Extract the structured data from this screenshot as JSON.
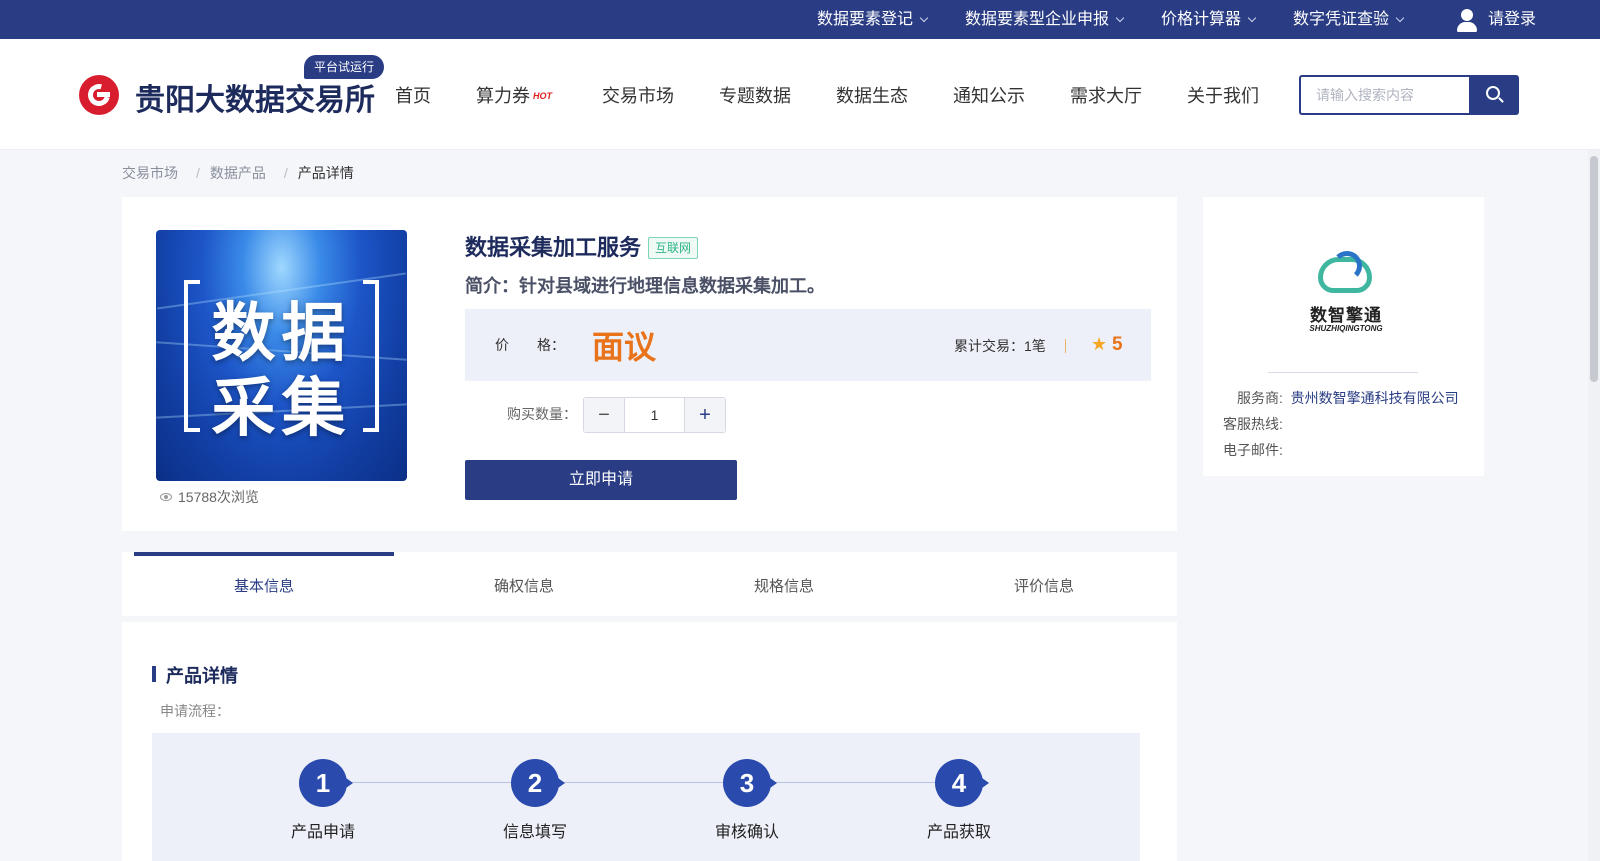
{
  "topbar": {
    "items": [
      {
        "label": "数据要素登记"
      },
      {
        "label": "数据要素型企业申报"
      },
      {
        "label": "价格计算器"
      },
      {
        "label": "数字凭证查验"
      }
    ],
    "login_label": "请登录"
  },
  "header": {
    "logo_text": "贵阳大数据交易所",
    "logo_badge": "平台试运行",
    "nav": [
      {
        "label": "首页"
      },
      {
        "label": "算力券",
        "badge": "HOT"
      },
      {
        "label": "交易市场"
      },
      {
        "label": "专题数据"
      },
      {
        "label": "数据生态"
      },
      {
        "label": "通知公示"
      },
      {
        "label": "需求大厅"
      },
      {
        "label": "关于我们"
      }
    ],
    "search_placeholder": "请输入搜索内容"
  },
  "breadcrumb": [
    "交易市场",
    "数据产品",
    "产品详情"
  ],
  "product": {
    "image_text_line1": "数据",
    "image_text_line2": "采集",
    "views": "15788次浏览",
    "title": "数据采集加工服务",
    "tag": "互联网",
    "intro": "简介：针对县域进行地理信息数据采集加工。",
    "price_label": "价　　格：",
    "price_value": "面议",
    "deals": "累计交易：1笔",
    "rating": "5",
    "qty_label": "购买数量：",
    "qty_value": "1",
    "apply_label": "立即申请"
  },
  "vendor": {
    "logo_cn": "数智擎通",
    "logo_en": "SHUZHIQINGTONG",
    "provider_label": "服务商:",
    "provider_value": "贵州数智擎通科技有限公司",
    "hotline_label": "客服热线:",
    "hotline_value": "",
    "email_label": "电子邮件:",
    "email_value": ""
  },
  "tabs": [
    {
      "label": "基本信息",
      "active": true
    },
    {
      "label": "确权信息",
      "active": false
    },
    {
      "label": "规格信息",
      "active": false
    },
    {
      "label": "评价信息",
      "active": false
    }
  ],
  "detail": {
    "title": "产品详情",
    "flow_label": "申请流程：",
    "steps": [
      {
        "num": "1",
        "label": "产品申请"
      },
      {
        "num": "2",
        "label": "信息填写"
      },
      {
        "num": "3",
        "label": "审核确认"
      },
      {
        "num": "4",
        "label": "产品获取"
      }
    ]
  },
  "colors": {
    "brand": "#2a3d84",
    "price": "#e8731a",
    "logo_red": "#d81e2e"
  }
}
